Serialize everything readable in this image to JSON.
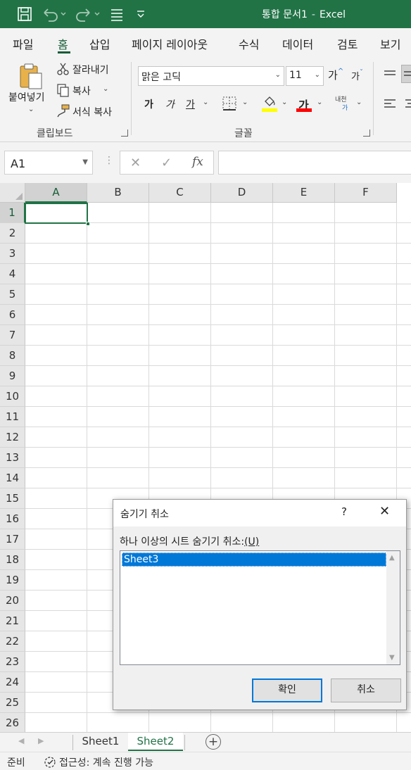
{
  "window": {
    "title": "통합 문서1",
    "app_name": "Excel",
    "separator": "-",
    "title_bar_color": "#217346"
  },
  "quick_access": [
    {
      "icon": "save-icon"
    },
    {
      "icon": "undo-icon"
    },
    {
      "icon": "redo-icon"
    },
    {
      "icon": "form-icon"
    },
    {
      "icon": "customize-dropdown-icon"
    }
  ],
  "menu": {
    "tabs": [
      {
        "label": "파일"
      },
      {
        "label": "홈",
        "active": true
      },
      {
        "label": "삽입"
      },
      {
        "label": "페이지 레이아웃"
      },
      {
        "label": "수식"
      },
      {
        "label": "데이터"
      },
      {
        "label": "검토"
      },
      {
        "label": "보기"
      }
    ]
  },
  "ribbon": {
    "clipboard": {
      "paste": "붙여넣기",
      "cut": "잘라내기",
      "copy": "복사",
      "format_painter": "서식 복사",
      "group_label": "클립보드"
    },
    "font": {
      "font_name": "맑은 고딕",
      "font_size": "11",
      "grow": "가",
      "shrink": "가",
      "bold": "가",
      "italic": "가",
      "underline": "가",
      "font_color": "가",
      "phonetic_top": "내천",
      "phonetic_bottom": "가",
      "group_label": "글꼴",
      "fill_color": "#ffff00",
      "font_color_bar": "#ff0000"
    }
  },
  "formula_bar": {
    "name_box": "A1",
    "cancel": "✕",
    "enter": "✓",
    "fx": "fx",
    "value": ""
  },
  "grid": {
    "columns": [
      "A",
      "B",
      "C",
      "D",
      "E",
      "F"
    ],
    "rows": [
      "1",
      "2",
      "3",
      "4",
      "5",
      "6",
      "7",
      "8",
      "9",
      "10",
      "11",
      "12",
      "13",
      "14",
      "15",
      "16",
      "17",
      "18",
      "19",
      "20",
      "21",
      "22",
      "23",
      "24",
      "25",
      "26"
    ],
    "active_cell": "A1"
  },
  "sheets": {
    "tabs": [
      {
        "label": "Sheet1",
        "active": false
      },
      {
        "label": "Sheet2",
        "active": true
      }
    ],
    "add": "+"
  },
  "status": {
    "ready": "준비",
    "accessibility": "접근성: 계속 진행 가능"
  },
  "dialog": {
    "title": "숨기기 취소",
    "help": "?",
    "close": "✕",
    "label": "하나 이상의 시트 숨기기 취소:",
    "label_hotkey": "(U)",
    "items": [
      "Sheet3"
    ],
    "ok": "확인",
    "cancel": "취소"
  }
}
